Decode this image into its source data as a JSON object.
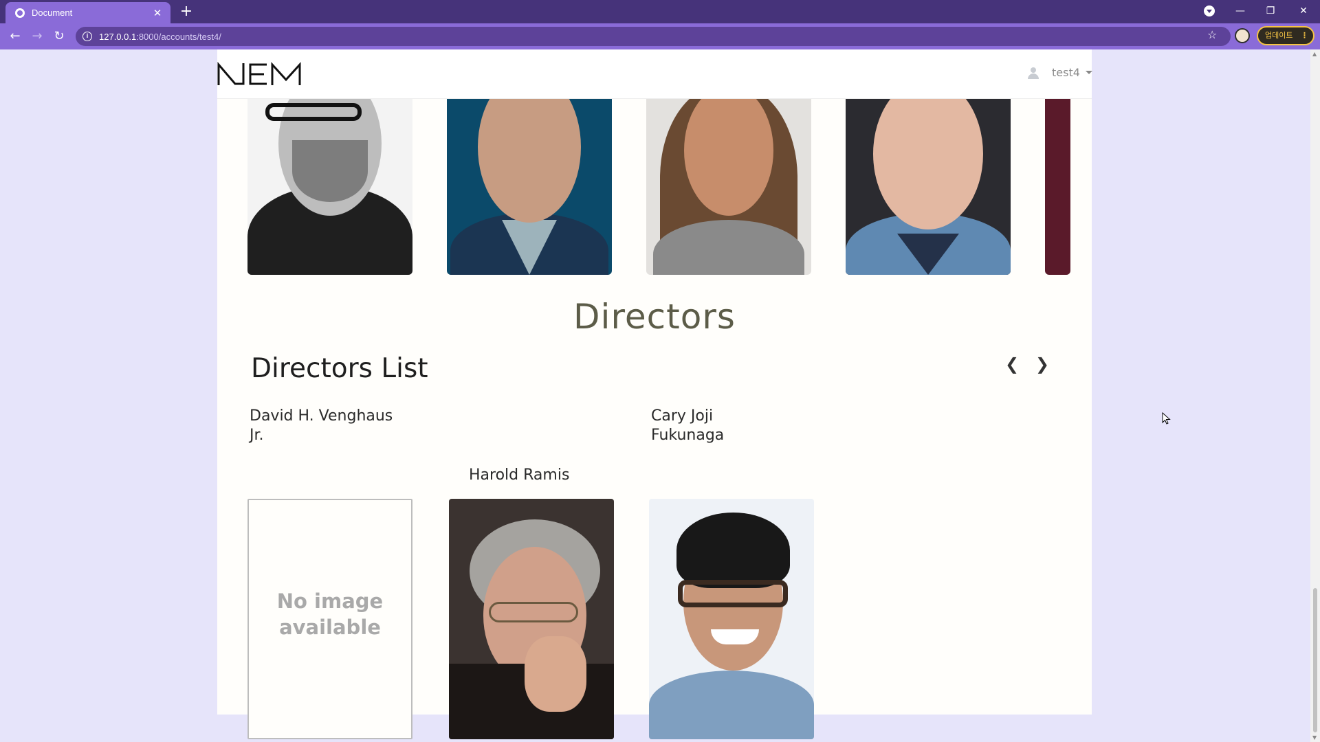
{
  "browser": {
    "tab_title": "Document",
    "url_host": "127.0.0.1",
    "url_path": ":8000/accounts/test4/",
    "update_label": "업데이트"
  },
  "header": {
    "logo_text": "NEM",
    "username": "test4"
  },
  "actors": [
    {
      "name": "actor-photo-1"
    },
    {
      "name": "actor-photo-2"
    },
    {
      "name": "actor-photo-3"
    },
    {
      "name": "actor-photo-4"
    },
    {
      "name": "actor-photo-5"
    }
  ],
  "directors_section": {
    "title": "Directors",
    "list_title": "Directors List",
    "prev_label": "❮",
    "next_label": "❯",
    "items": [
      {
        "name_line1": "David H. Venghaus",
        "name_line2": "Jr.",
        "no_image_line1": "No image",
        "no_image_line2": "available"
      },
      {
        "name_line1": "Harold Ramis",
        "name_line2": ""
      },
      {
        "name_line1": "Cary Joji",
        "name_line2": "Fukunaga"
      }
    ]
  }
}
